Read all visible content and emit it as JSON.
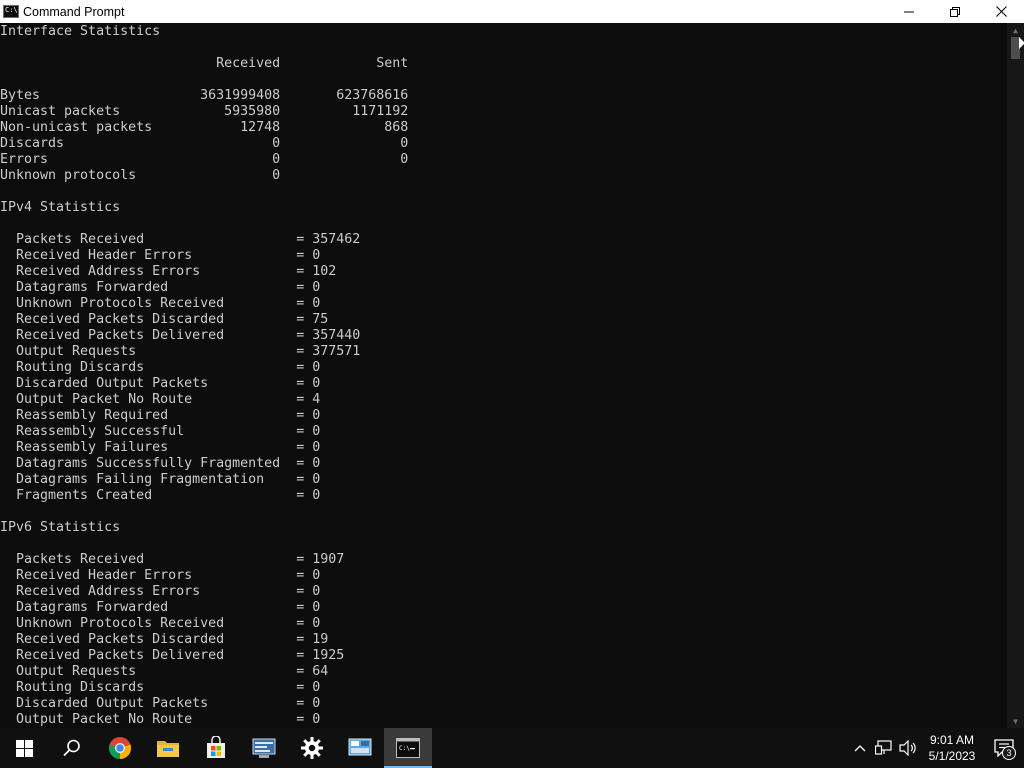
{
  "window": {
    "title": "Command Prompt",
    "minimize_label": "—",
    "restore_label": "❐",
    "close_label": "✕"
  },
  "console": {
    "text": "Interface Statistics\n\n                           Received            Sent\n\nBytes                    3631999408       623768616\nUnicast packets             5935980         1171192\nNon-unicast packets           12748             868\nDiscards                          0               0\nErrors                            0               0\nUnknown protocols                 0\n\nIPv4 Statistics\n\n  Packets Received                   = 357462\n  Received Header Errors             = 0\n  Received Address Errors            = 102\n  Datagrams Forwarded                = 0\n  Unknown Protocols Received         = 0\n  Received Packets Discarded         = 75\n  Received Packets Delivered         = 357440\n  Output Requests                    = 377571\n  Routing Discards                   = 0\n  Discarded Output Packets           = 0\n  Output Packet No Route             = 4\n  Reassembly Required                = 0\n  Reassembly Successful              = 0\n  Reassembly Failures                = 0\n  Datagrams Successfully Fragmented  = 0\n  Datagrams Failing Fragmentation    = 0\n  Fragments Created                  = 0\n\nIPv6 Statistics\n\n  Packets Received                   = 1907\n  Received Header Errors             = 0\n  Received Address Errors            = 0\n  Datagrams Forwarded                = 0\n  Unknown Protocols Received         = 0\n  Received Packets Discarded         = 19\n  Received Packets Delivered         = 1925\n  Output Requests                    = 64\n  Routing Discards                   = 0\n  Discarded Output Packets           = 0\n  Output Packet No Route             = 0"
  },
  "taskbar": {
    "apps": [
      {
        "name": "start-button",
        "icon": "windows-logo-icon"
      },
      {
        "name": "search-button",
        "icon": "search-icon"
      },
      {
        "name": "taskbar-chrome",
        "icon": "chrome-icon"
      },
      {
        "name": "taskbar-file-explorer",
        "icon": "folder-icon"
      },
      {
        "name": "taskbar-store",
        "icon": "store-icon"
      },
      {
        "name": "taskbar-control-panel",
        "icon": "control-panel-icon"
      },
      {
        "name": "taskbar-settings",
        "icon": "gear-icon"
      },
      {
        "name": "taskbar-network-app",
        "icon": "network-app-icon"
      },
      {
        "name": "taskbar-command-prompt",
        "icon": "cmd-icon",
        "active": true
      }
    ],
    "time": "9:01 AM",
    "date": "5/1/2023",
    "notification_count": "3"
  },
  "colors": {
    "console_bg": "#0c0c0c",
    "console_text": "#cccccc",
    "taskbar_bg": "#101010",
    "accent": "#76b9ed"
  }
}
